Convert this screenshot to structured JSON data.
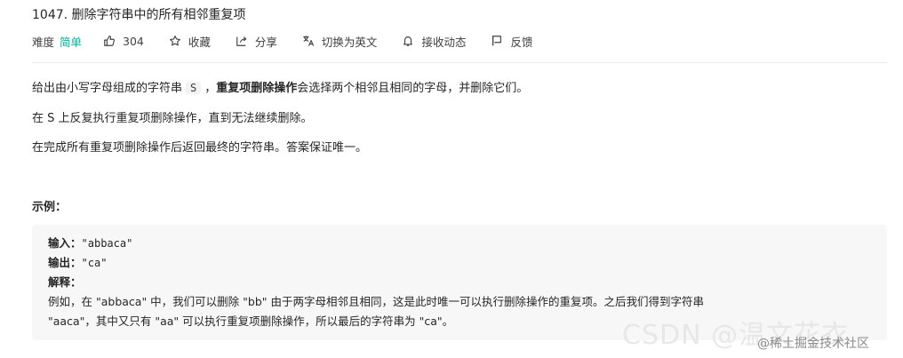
{
  "problem": {
    "title": "1047. 删除字符串中的所有相邻重复项"
  },
  "toolbar": {
    "difficulty_label": "难度",
    "difficulty_value": "简单",
    "difficulty_color": "#00af9b",
    "likes": "304",
    "collect": "收藏",
    "share": "分享",
    "switch_lang": "切换为英文",
    "notify": "接收动态",
    "feedback": "反馈"
  },
  "description": {
    "p1_before": "给出由小写字母组成的字符串",
    "p1_code": "S",
    "p1_sep": "，",
    "p1_bold": "重复项删除操作",
    "p1_after": "会选择两个相邻且相同的字母，并删除它们。",
    "p2": "在 S 上反复执行重复项删除操作，直到无法继续删除。",
    "p3": "在完成所有重复项删除操作后返回最终的字符串。答案保证唯一。"
  },
  "example": {
    "heading": "示例：",
    "input_label": "输入：",
    "input_value": "\"abbaca\"",
    "output_label": "输出：",
    "output_value": "\"ca\"",
    "explain_label": "解释：",
    "explain_line1": "例如，在 \"abbaca\" 中，我们可以删除 \"bb\" 由于两字母相邻且相同，这是此时唯一可以执行删除操作的重复项。之后我们得到字符串",
    "explain_line2": "\"aaca\"，其中又只有 \"aa\" 可以执行重复项删除操作，所以最后的字符串为 \"ca\"。"
  },
  "watermarks": {
    "csdn": "CSDN @温文花衣",
    "juejin": "@稀土掘金技术社区"
  }
}
